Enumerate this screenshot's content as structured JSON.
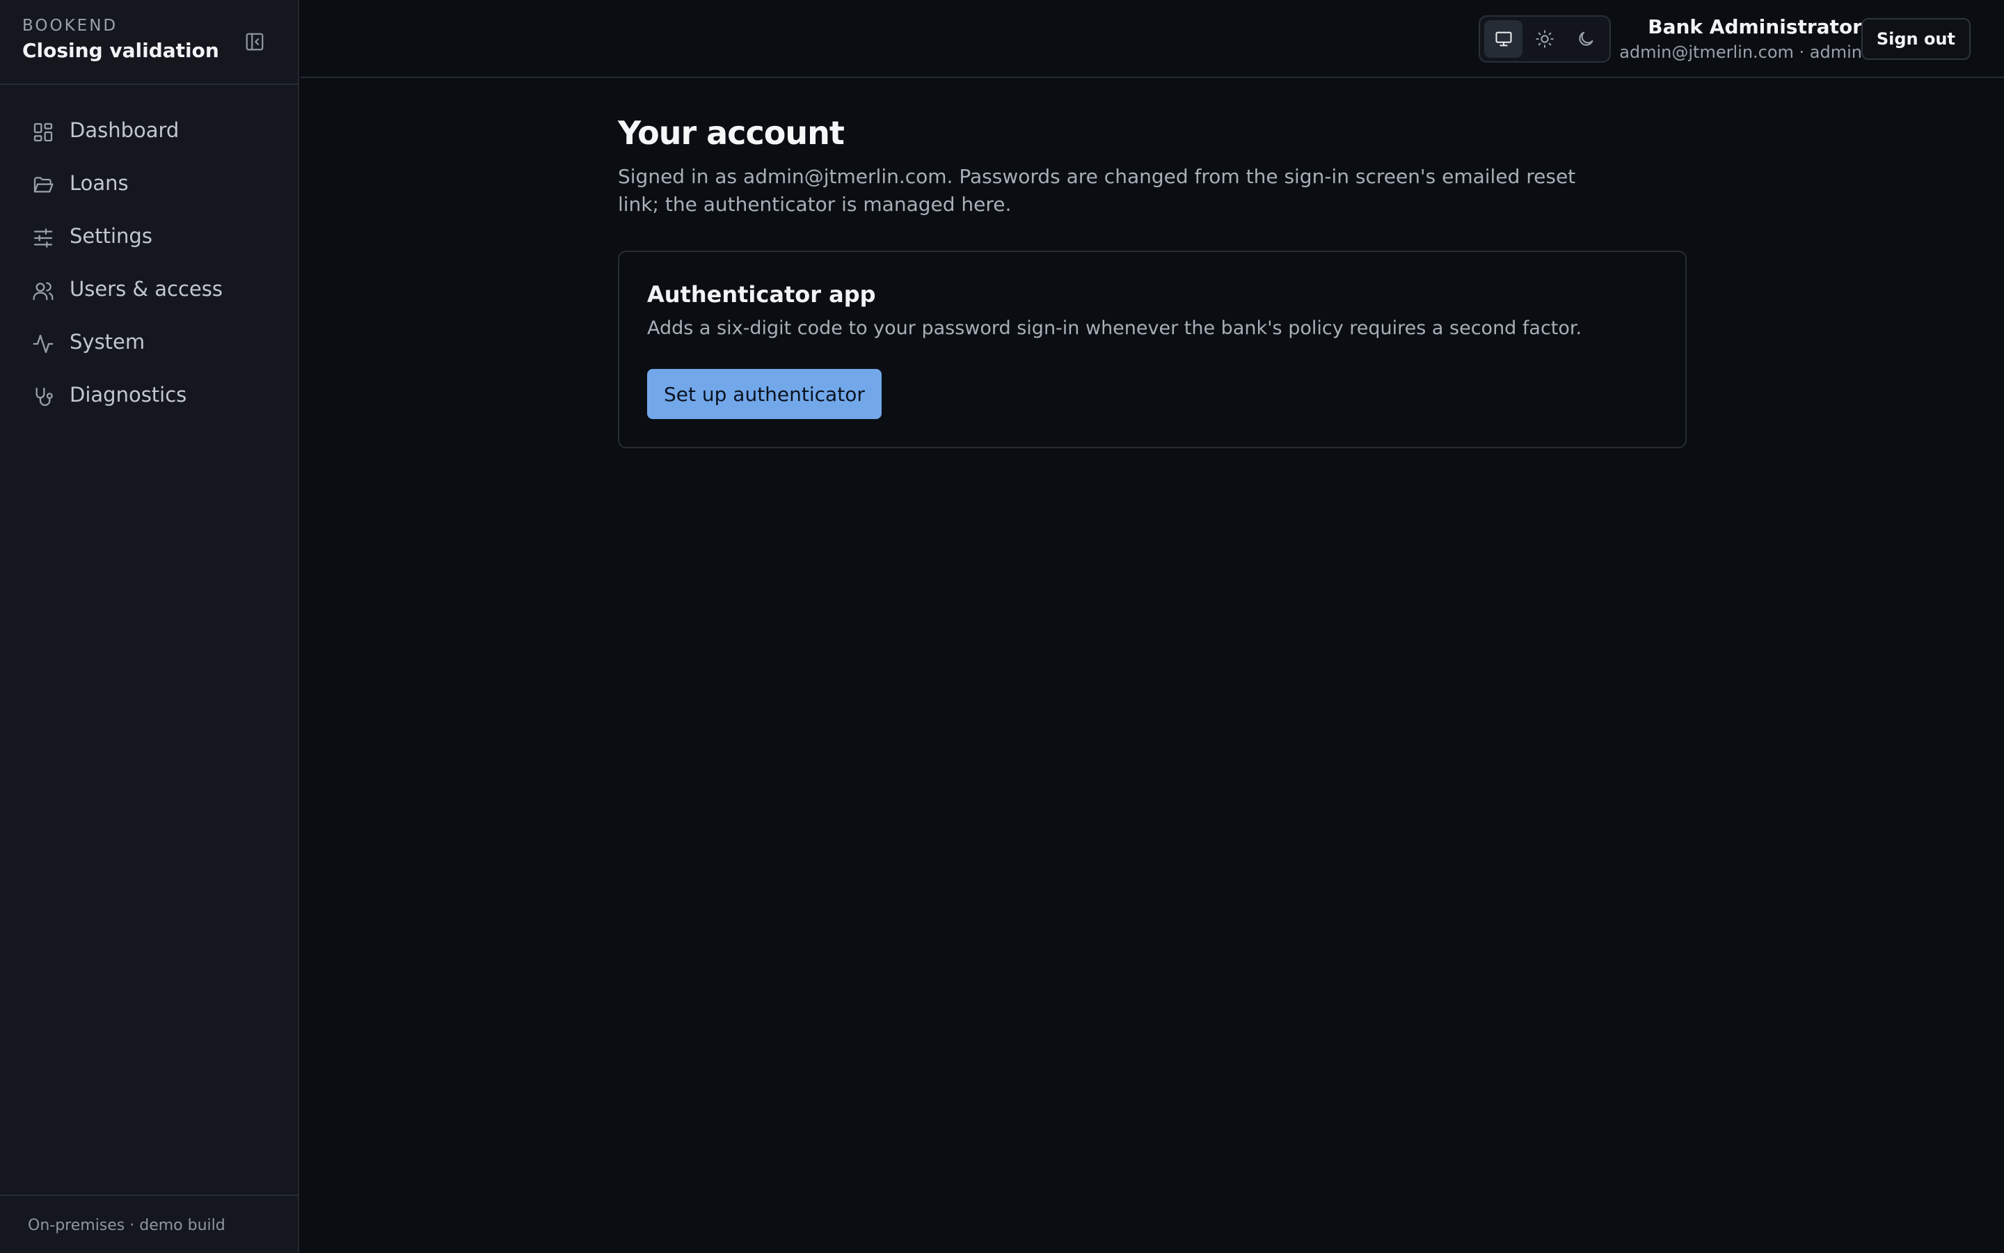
{
  "brand": {
    "small": "BOOKEND",
    "title": "Closing validation"
  },
  "sidebar": {
    "items": [
      {
        "label": "Dashboard",
        "icon": "dashboard-icon"
      },
      {
        "label": "Loans",
        "icon": "folder-open-icon"
      },
      {
        "label": "Settings",
        "icon": "sliders-icon"
      },
      {
        "label": "Users & access",
        "icon": "users-icon"
      },
      {
        "label": "System",
        "icon": "activity-icon"
      },
      {
        "label": "Diagnostics",
        "icon": "stethoscope-icon"
      }
    ],
    "footer": "On-premises · demo build"
  },
  "header": {
    "theme_options": [
      "monitor-icon",
      "sun-icon",
      "moon-icon"
    ],
    "theme_selected": "system",
    "user_name": "Bank Administrator",
    "user_email": "admin@jtmerlin.com · admin",
    "signout_label": "Sign out"
  },
  "main": {
    "title": "Your account",
    "description": "Signed in as admin@jtmerlin.com. Passwords are changed from the sign-in screen's emailed reset link; the authenticator is managed here.",
    "card": {
      "title": "Authenticator app",
      "description": "Adds a six-digit code to your password sign-in whenever the bank's policy requires a second factor.",
      "button_label": "Set up authenticator"
    }
  },
  "colors": {
    "background": "#0a0e13",
    "sidebar": "#14181e",
    "accent": "#72a8ea",
    "border": "#272c34"
  }
}
